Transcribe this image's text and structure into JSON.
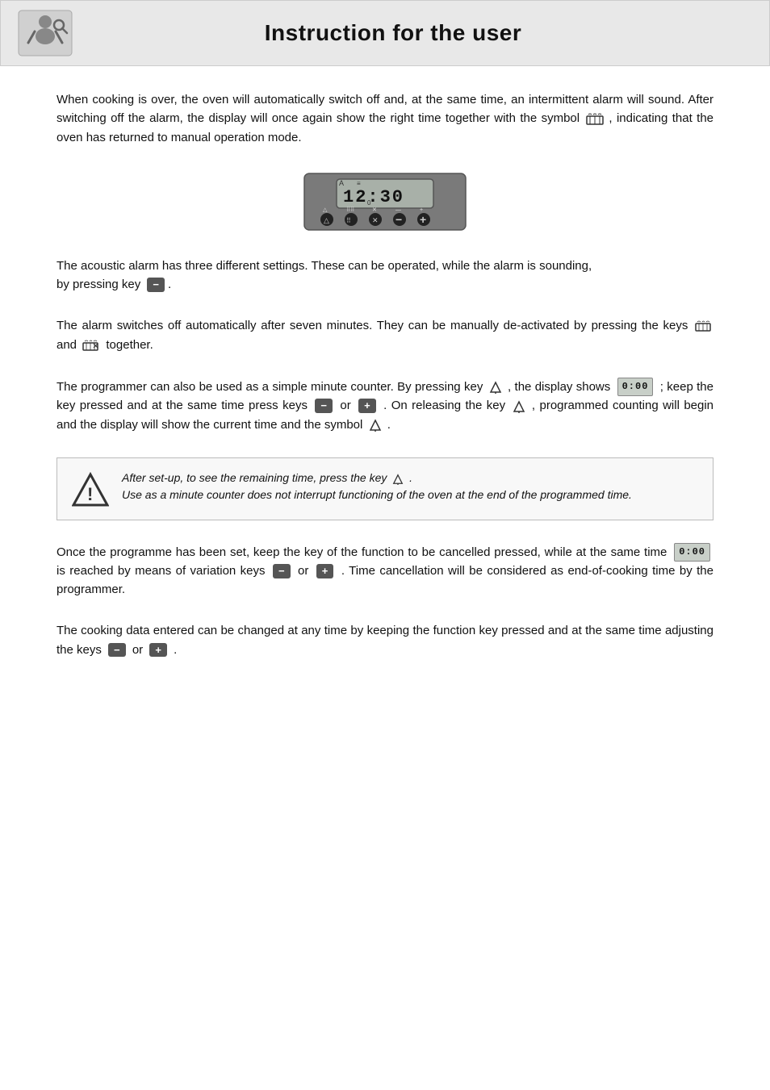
{
  "header": {
    "title": "Instruction for the user",
    "logo_alt": "user-instruction-logo"
  },
  "paragraphs": {
    "p1": "When cooking is over, the oven will automatically switch off and, at the same time, an intermittent alarm will sound. After switching off the alarm, the display will once again show the right time together with the symbol",
    "p1_end": ", indicating that the oven has returned to manual operation mode.",
    "p2_start": "The acoustic alarm has three different settings. These can be operated, while the alarm is sounding,",
    "p2_key_label": "by pressing key",
    "p2_end": ".",
    "p3_start": "The alarm switches off automatically after seven minutes. They can be manually de-activated by pressing the keys",
    "p3_end": "and",
    "p3_end2": "together.",
    "p4_start": "The programmer can also be used as a simple minute counter. By pressing key",
    "p4_mid1": ", the display shows",
    "p4_display": "0:00",
    "p4_mid2": "; keep the key pressed and at the same time press keys",
    "p4_or": "or",
    "p4_mid3": ". On releasing the key",
    "p4_end": ", programmed counting will begin and the display will show the current time and the symbol",
    "p4_end2": ".",
    "warning_line1": "After set-up, to see the remaining time, press the key",
    "warning_line2": "Use as a minute counter does not interrupt functioning of the oven at the end of the programmed time.",
    "p5_start": "Once the programme has been set, keep the key of the function to be cancelled pressed, while at the same time",
    "p5_display": "0:00",
    "p5_mid": "is reached by means of variation keys",
    "p5_or": "or",
    "p5_end": ". Time cancellation will be considered as end-of-cooking time by the programmer.",
    "p6_start": "The cooking data entered can be changed at any time by keeping the function key pressed and at the same time adjusting the keys",
    "p6_or": "or",
    "p6_end": "."
  },
  "display": {
    "time": "12:30",
    "time_display": "¹2₀30"
  },
  "buttons": [
    {
      "label": "△",
      "icon": "bell-key"
    },
    {
      "label": "⠿⠿",
      "icon": "wave-key"
    },
    {
      "label": "✕",
      "icon": "cancel-key"
    },
    {
      "label": "−",
      "icon": "minus-key"
    },
    {
      "label": "+",
      "icon": "plus-key"
    }
  ]
}
